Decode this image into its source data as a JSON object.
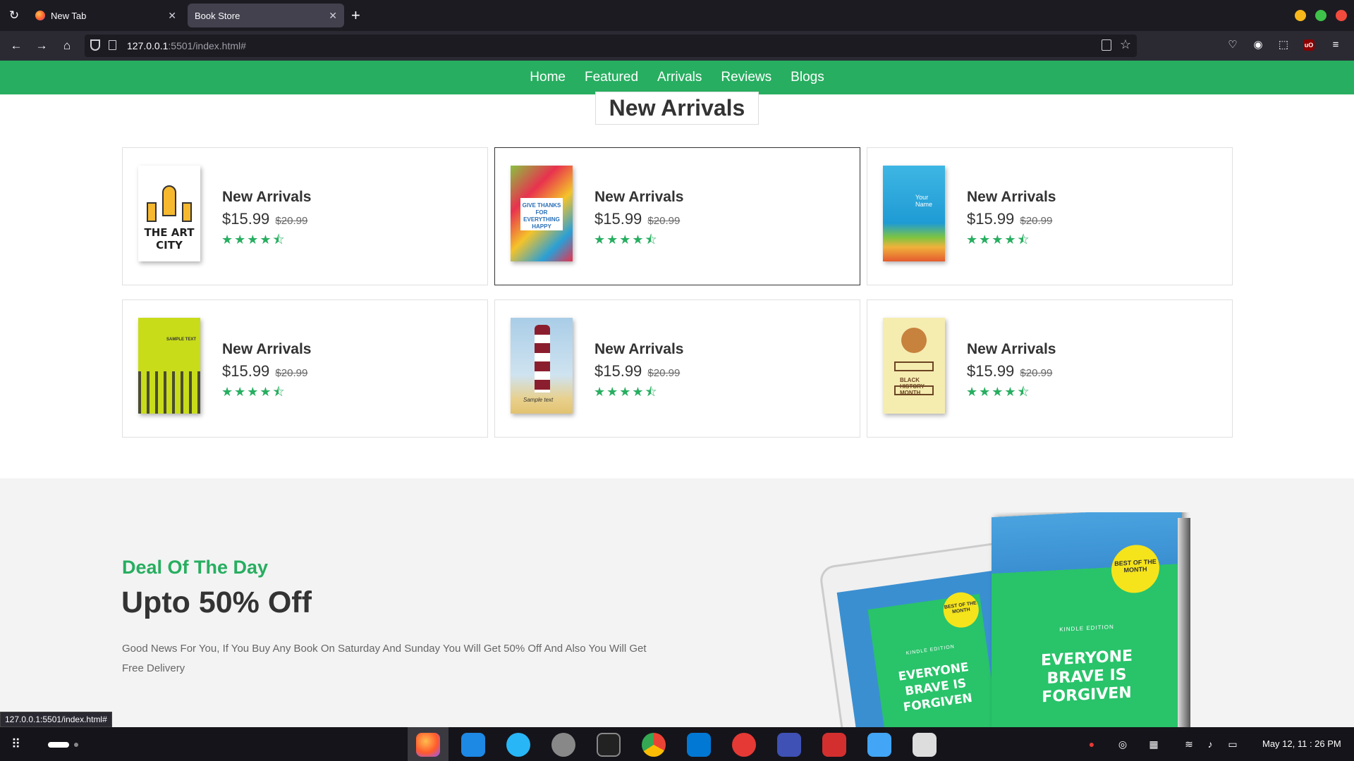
{
  "browser": {
    "tabs": [
      {
        "label": "New Tab"
      },
      {
        "label": "Book Store"
      }
    ],
    "url_host": "127.0.0.1",
    "url_rest": ":5501/index.html#",
    "status_link": "127.0.0.1:5501/index.html#"
  },
  "site_nav": {
    "items": [
      "Home",
      "Featured",
      "Arrivals",
      "Reviews",
      "Blogs"
    ]
  },
  "arrivals": {
    "heading": "New Arrivals",
    "cards": [
      {
        "name": "New Arrivals",
        "price": "$15.99",
        "old_price": "$20.99",
        "rating": 4.5,
        "cover_text": "THE ART CITY"
      },
      {
        "name": "New Arrivals",
        "price": "$15.99",
        "old_price": "$20.99",
        "rating": 4.5,
        "cover_text": "GIVE THANKS FOR EVERYTHING HAPPY"
      },
      {
        "name": "New Arrivals",
        "price": "$15.99",
        "old_price": "$20.99",
        "rating": 4.5,
        "cover_text": "Your Name"
      },
      {
        "name": "New Arrivals",
        "price": "$15.99",
        "old_price": "$20.99",
        "rating": 4.5,
        "cover_text": "SAMPLE TEXT"
      },
      {
        "name": "New Arrivals",
        "price": "$15.99",
        "old_price": "$20.99",
        "rating": 4.5,
        "cover_text": "Sample text"
      },
      {
        "name": "New Arrivals",
        "price": "$15.99",
        "old_price": "$20.99",
        "rating": 4.5,
        "cover_text": "BLACK HISTORY MONTH"
      }
    ]
  },
  "deal": {
    "kicker": "Deal Of The Day",
    "title": "Upto 50% Off",
    "text": "Good News For You, If You Buy Any Book On Saturday And Sunday You Will Get 50% Off And Also You Will Get Free Delivery",
    "book_badge": "BEST OF THE MONTH",
    "book_edition": "KINDLE EDITION",
    "book_title": "EVERYONE BRAVE IS FORGIVEN"
  },
  "taskbar": {
    "clock": "May 12, 11 : 26 PM"
  },
  "colors": {
    "accent": "#27ae60",
    "chrome_dark": "#1c1b22"
  }
}
